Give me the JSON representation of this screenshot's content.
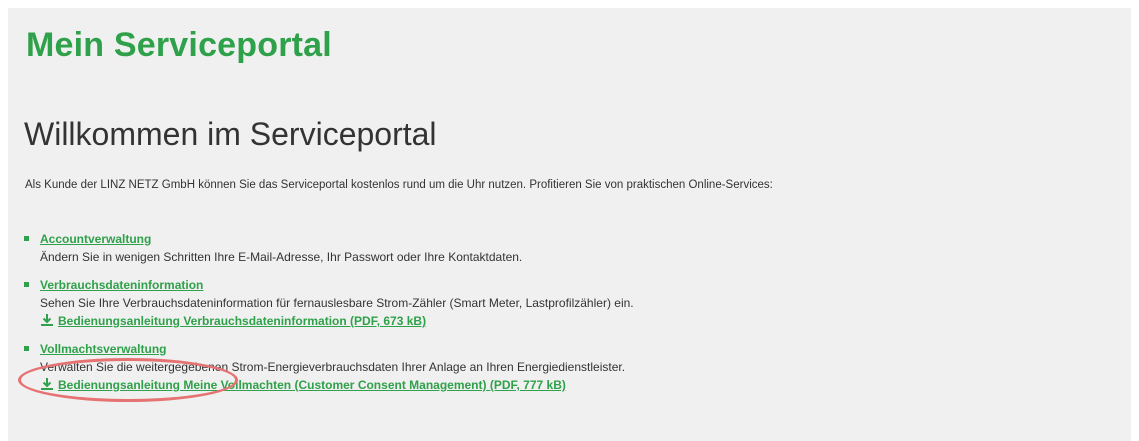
{
  "header": {
    "title": "Mein Serviceportal"
  },
  "main": {
    "heading": "Willkommen im Serviceportal",
    "intro": "Als Kunde der LINZ NETZ GmbH können Sie das Serviceportal kostenlos rund um die Uhr nutzen. Profitieren Sie von praktischen Online-Services:",
    "services": [
      {
        "title": "Accountverwaltung",
        "description": "Ändern Sie in wenigen Schritten Ihre E-Mail-Adresse, Ihr Passwort oder Ihre Kontaktdaten."
      },
      {
        "title": "Verbrauchsdateninformation",
        "description": "Sehen Sie Ihre Verbrauchsdateninformation für fernauslesbare Strom-Zähler (Smart Meter, Lastprofilzähler) ein.",
        "document": "Bedienungsanleitung Verbrauchsdateninformation (PDF, 673 kB)"
      },
      {
        "title": "Vollmachtsverwaltung",
        "description": "Verwalten Sie die weitergegebenen Strom-Energieverbrauchsdaten Ihrer Anlage an Ihren Energiedienstleister.",
        "document": "Bedienungsanleitung Meine Vollmachten (Customer Consent Management) (PDF, 777 kB)"
      }
    ]
  },
  "colors": {
    "brand_green": "#2fa14a",
    "text": "#333333",
    "panel_background": "#f0f0f0",
    "annotation_red": "#e57373"
  },
  "icons": {
    "bullet": "square-bullet-icon",
    "download": "download-icon"
  }
}
